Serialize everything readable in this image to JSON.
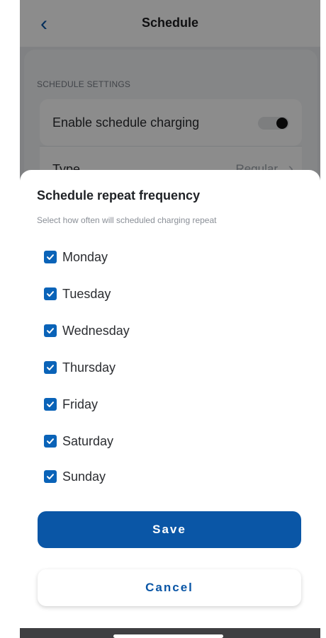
{
  "header": {
    "back_icon": "chevron-left-icon",
    "title": "Schedule"
  },
  "settings": {
    "section_label": "SCHEDULE SETTINGS",
    "enable_label": "Enable schedule charging",
    "enable_state": "off",
    "type_label": "Type",
    "type_value": "Regular"
  },
  "sheet": {
    "title": "Schedule repeat frequency",
    "subtitle": "Select how often will scheduled charging repeat",
    "days": [
      {
        "label": "Monday",
        "checked": true
      },
      {
        "label": "Tuesday",
        "checked": true
      },
      {
        "label": "Wednesday",
        "checked": true
      },
      {
        "label": "Thursday",
        "checked": true
      },
      {
        "label": "Friday",
        "checked": true
      },
      {
        "label": "Saturday",
        "checked": true
      },
      {
        "label": "Sunday",
        "checked": true
      }
    ],
    "save_label": "Save",
    "cancel_label": "Cancel"
  },
  "colors": {
    "primary": "#0a56a6",
    "checkbox": "#0a63b8"
  }
}
